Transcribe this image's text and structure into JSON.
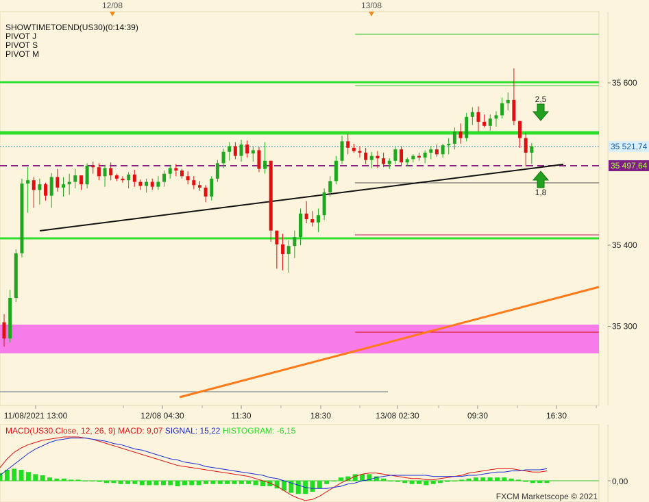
{
  "top_dates": [
    "12/08",
    "13/08"
  ],
  "indicators": [
    "SHOWTIMETOEND(US30)(0:14:39)",
    "PIVOT J",
    "PIVOT S",
    "PIVOT M"
  ],
  "price_axis": {
    "ticks": [
      {
        "value": 35600,
        "label": "35 600"
      },
      {
        "value": 35400,
        "label": "35 400"
      },
      {
        "value": 35300,
        "label": "35 300"
      }
    ]
  },
  "price_badges": [
    {
      "value": 35521.74,
      "label": "35 521,74",
      "bg": "#D9F0FA",
      "fg": "#1F5AA8"
    },
    {
      "value": 35497.64,
      "label": "35 497,64",
      "bg": "#7E1F86",
      "fg": "#B6F84A"
    }
  ],
  "time_axis": [
    "11/08/2021 13:00",
    "12/08 04:30",
    "11:30",
    "18:30",
    "13/08 02:30",
    "09:30",
    "16:30"
  ],
  "annotations": [
    {
      "text": "2,5",
      "arrow": "down"
    },
    {
      "text": "1,8",
      "arrow": "up"
    }
  ],
  "macd_legend": [
    {
      "text": "MACD(US30.Close, 12, 26, 9)",
      "color": "#E01010"
    },
    {
      "text": "MACD: 9,07",
      "color": "#E01010"
    },
    {
      "text": "SIGNAL: 15,22",
      "color": "#1A2BD4"
    },
    {
      "text": "HISTOGRAM: -6,15",
      "color": "#22DD22"
    }
  ],
  "macd_axis": {
    "ticks": [
      {
        "value": 0,
        "label": "0,00"
      }
    ]
  },
  "watermark": "FXCM Marketscope © 2021",
  "colors": {
    "background": "#FCF4DC",
    "bull": "#1FA81F",
    "bear": "#E01010",
    "pivot_line": "#2EE02E",
    "pink_zone": "#F67CE9",
    "orange_trend": "#FF7A1A",
    "purple_dash": "#8A1F86"
  },
  "chart_data": [
    {
      "type": "candlestick",
      "title": "US30",
      "ylim": [
        35200,
        35690
      ],
      "horizontal_levels": [
        35600,
        35538,
        35498,
        35408
      ],
      "zone": [
        35267,
        35302
      ],
      "trendlines": [
        {
          "from": [
            0,
            35419
          ],
          "to": [
            100,
            35497
          ]
        },
        {
          "from": [
            31,
            35196
          ],
          "to": [
            100,
            35350
          ]
        }
      ],
      "ohlc": [
        [
          35305,
          35315,
          35275,
          35285
        ],
        [
          35285,
          35345,
          35280,
          35335
        ],
        [
          35335,
          35395,
          35330,
          35390
        ],
        [
          35390,
          35482,
          35385,
          35476
        ],
        [
          35476,
          35496,
          35440,
          35480
        ],
        [
          35480,
          35484,
          35446,
          35468
        ],
        [
          35468,
          35482,
          35450,
          35475
        ],
        [
          35475,
          35477,
          35455,
          35461
        ],
        [
          35461,
          35489,
          35446,
          35484
        ],
        [
          35484,
          35494,
          35466,
          35471
        ],
        [
          35471,
          35484,
          35460,
          35475
        ],
        [
          35475,
          35488,
          35462,
          35478
        ],
        [
          35478,
          35494,
          35470,
          35486
        ],
        [
          35486,
          35486,
          35468,
          35475
        ],
        [
          35475,
          35501,
          35470,
          35498
        ],
        [
          35498,
          35503,
          35488,
          35496
        ],
        [
          35496,
          35501,
          35480,
          35485
        ],
        [
          35485,
          35499,
          35472,
          35495
        ],
        [
          35495,
          35502,
          35480,
          35486
        ],
        [
          35486,
          35488,
          35479,
          35482
        ],
        [
          35482,
          35485,
          35477,
          35480
        ],
        [
          35480,
          35490,
          35470,
          35487
        ],
        [
          35487,
          35493,
          35472,
          35478
        ],
        [
          35478,
          35481,
          35468,
          35473
        ],
        [
          35473,
          35482,
          35465,
          35478
        ],
        [
          35478,
          35482,
          35468,
          35472
        ],
        [
          35472,
          35485,
          35468,
          35478
        ],
        [
          35478,
          35492,
          35472,
          35488
        ],
        [
          35488,
          35499,
          35482,
          35495
        ],
        [
          35495,
          35500,
          35485,
          35492
        ],
        [
          35492,
          35494,
          35482,
          35485
        ],
        [
          35485,
          35491,
          35475,
          35480
        ],
        [
          35480,
          35485,
          35469,
          35474
        ],
        [
          35474,
          35479,
          35467,
          35471
        ],
        [
          35471,
          35474,
          35453,
          35460
        ],
        [
          35460,
          35485,
          35455,
          35482
        ],
        [
          35482,
          35505,
          35478,
          35501
        ],
        [
          35501,
          35519,
          35495,
          35515
        ],
        [
          35515,
          35527,
          35504,
          35522
        ],
        [
          35522,
          35527,
          35506,
          35510
        ],
        [
          35510,
          35530,
          35503,
          35524
        ],
        [
          35524,
          35529,
          35508,
          35513
        ],
        [
          35513,
          35522,
          35503,
          35517
        ],
        [
          35517,
          35521,
          35490,
          35494
        ],
        [
          35494,
          35527,
          35488,
          35504
        ],
        [
          35504,
          35504,
          35404,
          35418
        ],
        [
          35418,
          35418,
          35371,
          35401
        ],
        [
          35401,
          35414,
          35369,
          35389
        ],
        [
          35389,
          35406,
          35366,
          35399
        ],
        [
          35399,
          35418,
          35384,
          35410
        ],
        [
          35410,
          35445,
          35400,
          35439
        ],
        [
          35439,
          35454,
          35427,
          35432
        ],
        [
          35432,
          35442,
          35423,
          35428
        ],
        [
          35428,
          35445,
          35416,
          35437
        ],
        [
          35437,
          35470,
          35431,
          35465
        ],
        [
          35465,
          35485,
          35460,
          35479
        ],
        [
          35479,
          35510,
          35475,
          35504
        ],
        [
          35504,
          35535,
          35500,
          35528
        ],
        [
          35528,
          35537,
          35512,
          35520
        ],
        [
          35520,
          35525,
          35514,
          35516
        ],
        [
          35516,
          35522,
          35508,
          35514
        ],
        [
          35514,
          35520,
          35500,
          35505
        ],
        [
          35505,
          35515,
          35495,
          35510
        ],
        [
          35510,
          35516,
          35495,
          35507
        ],
        [
          35507,
          35514,
          35496,
          35500
        ],
        [
          35500,
          35507,
          35494,
          35504
        ],
        [
          35504,
          35521,
          35500,
          35518
        ],
        [
          35518,
          35522,
          35498,
          35502
        ],
        [
          35502,
          35508,
          35497,
          35506
        ],
        [
          35506,
          35512,
          35502,
          35510
        ],
        [
          35510,
          35514,
          35504,
          35508
        ],
        [
          35508,
          35517,
          35501,
          35514
        ],
        [
          35514,
          35522,
          35506,
          35518
        ],
        [
          35518,
          35524,
          35509,
          35512
        ],
        [
          35512,
          35525,
          35508,
          35523
        ],
        [
          35523,
          35532,
          35512,
          35525
        ],
        [
          35525,
          35545,
          35518,
          35540
        ],
        [
          35540,
          35550,
          35525,
          35532
        ],
        [
          35532,
          35563,
          35528,
          35558
        ],
        [
          35558,
          35570,
          35548,
          35564
        ],
        [
          35564,
          35571,
          35540,
          35552
        ],
        [
          35552,
          35561,
          35545,
          35547
        ],
        [
          35547,
          35561,
          35541,
          35556
        ],
        [
          35556,
          35565,
          35546,
          35560
        ],
        [
          35560,
          35582,
          35556,
          35575
        ],
        [
          35575,
          35588,
          35566,
          35579
        ],
        [
          35579,
          35618,
          35548,
          35553
        ],
        [
          35553,
          35553,
          35520,
          35532
        ],
        [
          35532,
          35538,
          35497,
          35514
        ],
        [
          35514,
          35526,
          35500,
          35522
        ]
      ],
      "annotations": [
        {
          "value": 2.5,
          "marker": "down-arrow"
        },
        {
          "value": 1.8,
          "marker": "up-arrow"
        }
      ]
    },
    {
      "type": "bar+line",
      "title": "MACD(US30.Close, 12, 26, 9)",
      "ylim": [
        -25,
        45
      ],
      "series": [
        {
          "name": "MACD",
          "color": "#E01010",
          "values": [
            12,
            20,
            26,
            30,
            33,
            35,
            37,
            38,
            39,
            40,
            40,
            40,
            39,
            38,
            36,
            34,
            32,
            30,
            28,
            26,
            24,
            22,
            20,
            18,
            16,
            14,
            13,
            12,
            11,
            10,
            9,
            8,
            7,
            6,
            5,
            4,
            2,
            0,
            -2,
            -5,
            -9,
            -13,
            -16,
            -18,
            -17,
            -14,
            -10,
            -6,
            -2,
            1,
            4,
            6,
            7,
            7,
            6,
            5,
            4,
            3,
            2,
            2,
            1,
            1,
            2,
            3,
            4,
            5,
            7,
            8,
            9,
            10,
            11,
            11,
            11,
            10,
            9,
            8,
            8,
            9
          ]
        },
        {
          "name": "SIGNAL",
          "color": "#1A2BD4",
          "values": [
            5,
            10,
            15,
            20,
            25,
            29,
            32,
            35,
            37,
            38,
            39,
            39,
            39,
            38,
            37,
            36,
            34,
            33,
            31,
            29,
            28,
            26,
            24,
            22,
            20,
            19,
            17,
            16,
            15,
            13,
            12,
            11,
            10,
            9,
            8,
            7,
            6,
            5,
            3,
            2,
            0,
            -2,
            -4,
            -6,
            -7,
            -7,
            -7,
            -6,
            -5,
            -3,
            -2,
            0,
            1,
            3,
            4,
            5,
            5,
            5,
            5,
            5,
            5,
            4,
            4,
            4,
            4,
            4,
            5,
            5,
            6,
            7,
            8,
            8,
            9,
            9,
            10,
            10,
            10,
            11
          ]
        },
        {
          "name": "HISTOGRAM",
          "color": "#22DD22",
          "values": [
            7,
            10,
            11,
            10,
            8,
            6,
            5,
            3,
            2,
            2,
            1,
            1,
            0,
            0,
            -1,
            -2,
            -2,
            -3,
            -3,
            -3,
            -4,
            -4,
            -4,
            -4,
            -4,
            -5,
            -4,
            -4,
            -4,
            -3,
            -3,
            -3,
            -3,
            -3,
            -3,
            -3,
            -4,
            -5,
            -5,
            -7,
            -9,
            -11,
            -12,
            -12,
            -10,
            -7,
            -3,
            0,
            3,
            4,
            6,
            6,
            6,
            4,
            2,
            0,
            -1,
            -2,
            -3,
            -3,
            -4,
            -3,
            -2,
            -1,
            0,
            1,
            2,
            3,
            3,
            3,
            3,
            3,
            2,
            1,
            -1,
            -2,
            -2,
            -2
          ]
        }
      ]
    }
  ]
}
